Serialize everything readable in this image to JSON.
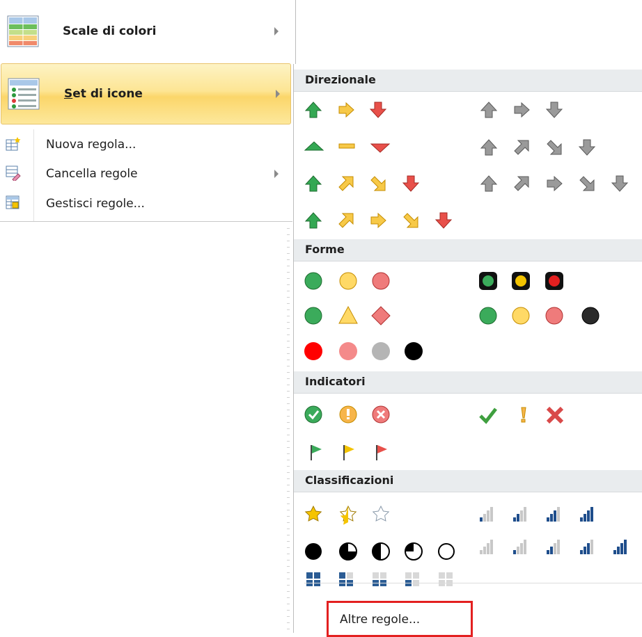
{
  "left_menu": {
    "scale_colori": "Scale di colori",
    "set_icone": "Set di icone",
    "nuova_regola": "Nuova regola...",
    "cancella_regole": "Cancella regole",
    "gestisci_regole": "Gestisci regole..."
  },
  "sections": {
    "direzionale": "Direzionale",
    "forme": "Forme",
    "indicatori": "Indicatori",
    "classificazioni": "Classificazioni"
  },
  "footer": {
    "altre_regole": "Altre regole..."
  },
  "colors": {
    "green": "#2e9a3e",
    "yellow": "#f3b800",
    "red": "#e03a3a",
    "gray": "#8c8c8c",
    "hover_gradient": "#fde594",
    "highlight_border": "#e32020",
    "navy": "#1f4e8c"
  },
  "icons": {
    "directional_row1": [
      "arrow-up-green-icon",
      "arrow-right-yellow-icon",
      "arrow-down-red-icon"
    ],
    "directional_row1_gray": [
      "arrow-up-gray-icon",
      "arrow-right-gray-icon",
      "arrow-down-gray-icon"
    ],
    "forme_row1": [
      "circle-green-icon",
      "circle-yellow-icon",
      "circle-red-icon"
    ],
    "traffic_lights": [
      "traffic-light-green-icon",
      "traffic-light-yellow-icon",
      "traffic-light-red-icon"
    ],
    "indicatori_row1": [
      "check-circle-icon",
      "exclamation-circle-icon",
      "x-circle-icon"
    ],
    "indicatori_row2": [
      "check-mark-icon",
      "exclamation-icon",
      "x-mark-icon"
    ],
    "flags": [
      "flag-green-icon",
      "flag-yellow-icon",
      "flag-red-icon"
    ]
  }
}
